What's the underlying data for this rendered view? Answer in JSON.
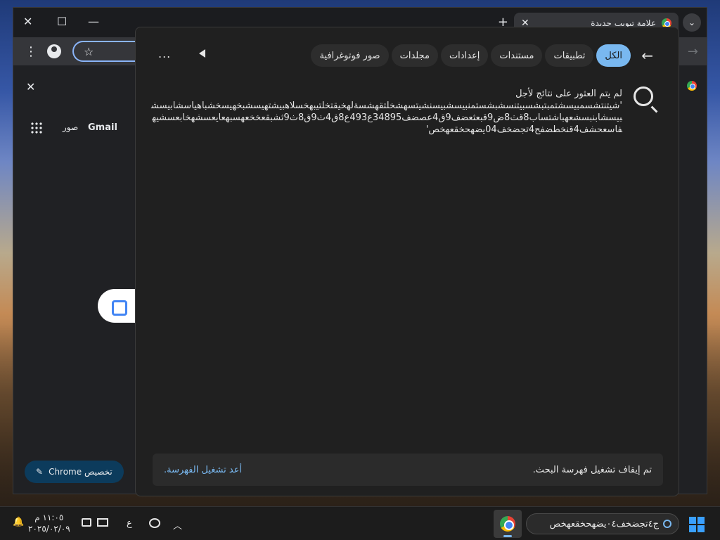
{
  "chrome": {
    "tab_title": "علامة تبويب جديدة",
    "tab_close_icon": "✕",
    "new_tab_icon": "+",
    "tab_search_icon": "⌄",
    "min_icon": "—",
    "max_icon": "☐",
    "close_icon": "✕",
    "bookmark_icon": "☆",
    "menu_icon": "⋮",
    "forward_icon": "→",
    "banner_close_icon": "✕",
    "shortcut_gmail": "Gmail",
    "shortcut_images": "صور",
    "customize_label": "تخصيص Chrome",
    "customize_icon": "✎"
  },
  "search_panel": {
    "back_icon": "←",
    "tabs": [
      {
        "label": "الكل",
        "active": true
      },
      {
        "label": "تطبيقات",
        "active": false
      },
      {
        "label": "مستندات",
        "active": false
      },
      {
        "label": "إعدادات",
        "active": false
      },
      {
        "label": "مجلدات",
        "active": false
      },
      {
        "label": "صور فوتوغرافية",
        "active": false
      }
    ],
    "more_icon": "...",
    "no_results_heading": "لم يتم العثور على نتائج لأجل",
    "query_text": "'شيتنتشسمبيسشتمبتبشسبيتنسشبشستمنبيسشبيسنشيتسهشخلتقهشسةلهخيقتخلتيبهخسلاهبيشتهيسشبخهيسخشباهياسشابيسشبيسشابنبسشعهباشتساب8قث8ض9قبعثعضف9ق4عصضف34895ع493ع8ق4ث9ق8ث9ثشبقعخخعهسبهعايعسشهخابعسشيهفاسعحشف4قنخطضفح4تجضخف04يضهحخقعهخص'",
    "footer_message": "تم إيقاف تشغيل فهرسة البحث.",
    "footer_link": "أعد تشغيل الفهرسة."
  },
  "taskbar": {
    "search_query": "ج٤تجضخف٠٤يضهحخقعهخص",
    "chevron_icon": "︿",
    "language": "ع",
    "time": "١١:٠٥ م",
    "date": "٢٠٢٥/٠٢/٠٩",
    "notification_icon": "🔔"
  },
  "colors": {
    "accent": "#79b8f0",
    "panel_bg": "#202020",
    "taskbar_bg": "#1c1c1c"
  }
}
